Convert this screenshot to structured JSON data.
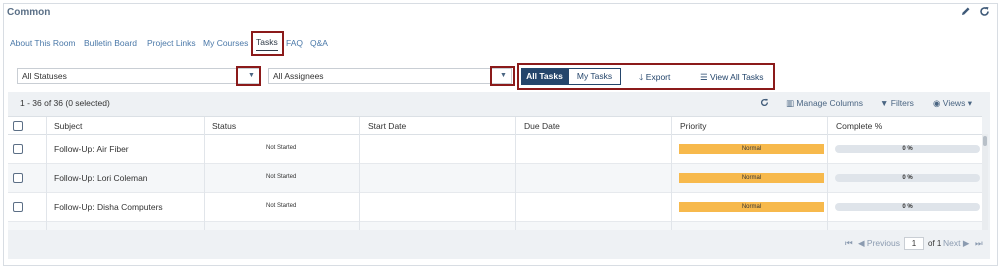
{
  "panel": {
    "title": "Common",
    "edit_icon": "pencil-icon",
    "refresh_icon": "refresh-icon"
  },
  "tabs": [
    {
      "label": "About This Room"
    },
    {
      "label": "Bulletin Board"
    },
    {
      "label": "Project Links"
    },
    {
      "label": "My Courses"
    },
    {
      "label": "Tasks",
      "active": true
    },
    {
      "label": "FAQ"
    },
    {
      "label": "Q&A"
    }
  ],
  "filters": {
    "status_value": "All Statuses",
    "assignee_value": "All Assignees"
  },
  "toolbar": {
    "all_tasks": "All Tasks",
    "my_tasks": "My Tasks",
    "export": "Export",
    "view_all": "View All Tasks"
  },
  "grid": {
    "count_text": "1 - 36 of 36 (0 selected)",
    "manage_columns": "Manage Columns",
    "filters": "Filters",
    "views": "Views"
  },
  "columns": [
    "Subject",
    "Status",
    "Start Date",
    "Due Date",
    "Priority",
    "Complete %"
  ],
  "rows": [
    {
      "subject": "Follow-Up: Air Fiber",
      "status": "Not Started",
      "start": "",
      "due": "",
      "priority": "Normal",
      "complete": "0 %"
    },
    {
      "subject": "Follow-Up: Lori Coleman",
      "status": "Not Started",
      "start": "",
      "due": "",
      "priority": "Normal",
      "complete": "0 %"
    },
    {
      "subject": "Follow-Up: Disha Computers",
      "status": "Not Started",
      "start": "",
      "due": "",
      "priority": "Normal",
      "complete": "0 %"
    }
  ],
  "pager": {
    "previous": "Previous",
    "page": "1",
    "of": "of 1",
    "next": "Next"
  },
  "colors": {
    "accent": "#24456b",
    "priority_normal": "#f7b94c",
    "highlight_box": "#8b1a1a"
  }
}
